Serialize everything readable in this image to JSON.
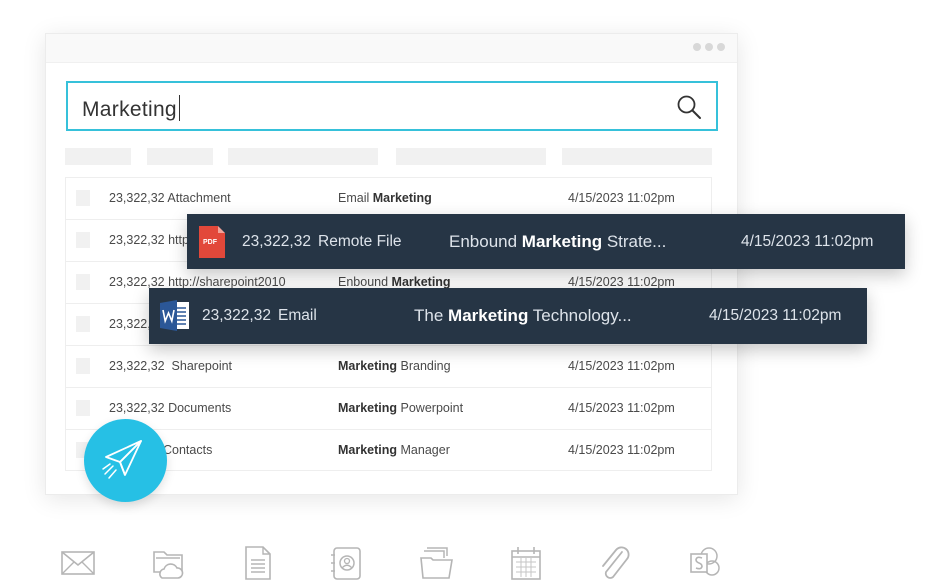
{
  "search": {
    "value": "Marketing"
  },
  "table": {
    "rows": [
      {
        "col1": "23,322,32 Attachment",
        "col2_pre": "Email ",
        "col2_bold": "Marketing",
        "col2_post": "",
        "date": "4/15/2023 11:02pm"
      },
      {
        "col1": "23,322,32 http",
        "col2_pre": "",
        "col2_bold": "",
        "col2_post": "",
        "date": ""
      },
      {
        "col1": "23,322,32 http://sharepoint2010",
        "col2_pre": "Enbound ",
        "col2_bold": "Marketing",
        "col2_post": "",
        "date": "4/15/2023 11:02pm"
      },
      {
        "col1": "23,322,",
        "col2_pre": "",
        "col2_bold": "",
        "col2_post": "",
        "date": ""
      },
      {
        "col1": "23,322,32  Sharepoint",
        "col2_pre": "",
        "col2_bold": "Marketing",
        "col2_post": " Branding",
        "date": "4/15/2023 11:02pm"
      },
      {
        "col1": "23,322,32 Documents",
        "col2_pre": "",
        "col2_bold": "Marketing",
        "col2_post": " Powerpoint",
        "date": "4/15/2023 11:02pm"
      },
      {
        "col1": "Contacts",
        "col2_pre": "",
        "col2_bold": "Marketing",
        "col2_post": " Manager",
        "date": "4/15/2023 11:02pm"
      }
    ]
  },
  "floating_rows": [
    {
      "icon": "pdf-icon",
      "icon_label": "PDF",
      "id": "23,322,32",
      "type": "Remote File",
      "title_pre": "Enbound ",
      "title_bold": "Marketing",
      "title_post": " Strate...",
      "date": "4/15/2023 11:02pm"
    },
    {
      "icon": "word-icon",
      "id": "23,322,32",
      "type": "Email",
      "title_pre": "The ",
      "title_bold": "Marketing",
      "title_post": " Technology...",
      "date": "4/15/2023 11:02pm"
    }
  ],
  "icons": {
    "send": "paper-plane-icon",
    "bottom": [
      "email-icon",
      "cloud-folder-icon",
      "document-icon",
      "contacts-icon",
      "files-icon",
      "calendar-icon",
      "attachment-icon",
      "sharepoint-icon"
    ]
  },
  "colors": {
    "accent": "#26c0e5",
    "search_border": "#36c1da",
    "float_bg": "#263545",
    "pdf_red": "#e2483a",
    "word_blue": "#2b5797"
  }
}
